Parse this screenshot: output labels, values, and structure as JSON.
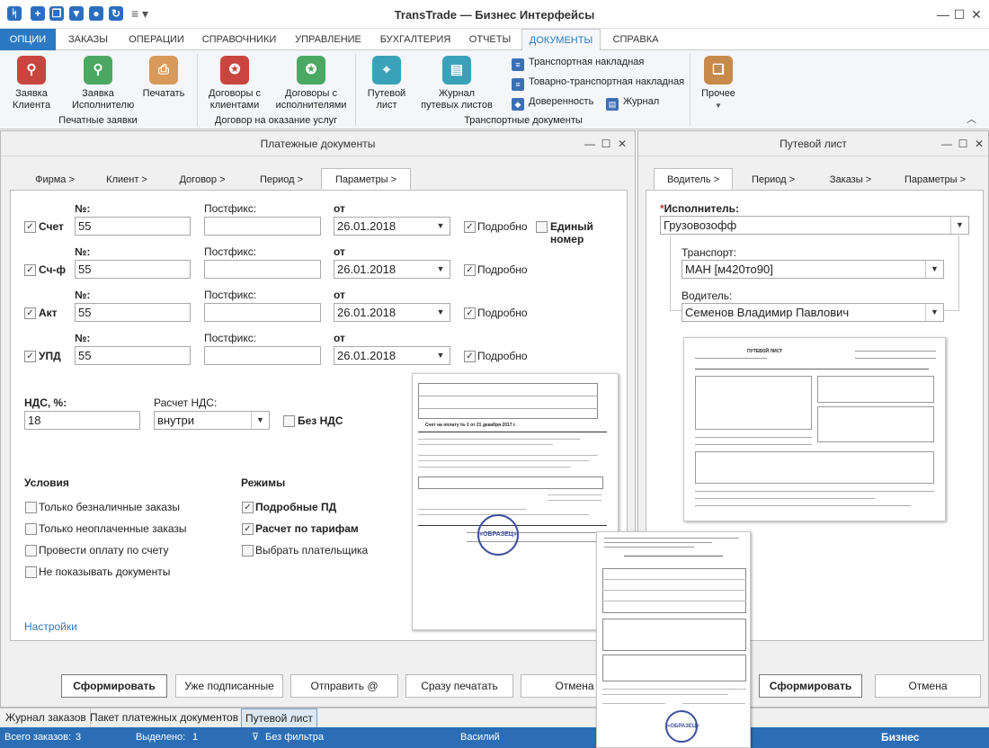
{
  "app": {
    "title": "TransTrade — Бизнес Интерфейсы"
  },
  "menu_tabs": [
    "ОПЦИИ",
    "ЗАКАЗЫ",
    "ОПЕРАЦИИ",
    "СПРАВОЧНИКИ",
    "УПРАВЛЕНИЕ",
    "БУХГАЛТЕРИЯ",
    "ОТЧЕТЫ",
    "ДОКУМЕНТЫ",
    "СПРАВКА"
  ],
  "ribbon": {
    "print_orders": {
      "client": "Заявка\nКлиента",
      "executor": "Заявка\nИсполнителю",
      "print": "Печатать",
      "group": "Печатные заявки"
    },
    "contracts": {
      "clients": "Договоры с\nклиентами",
      "executors": "Договоры с\nисполнителями",
      "group": "Договор на оказание услуг"
    },
    "transport": {
      "waybill": "Путевой\nлист",
      "waybill_journal": "Журнал\nпутевых листов",
      "consignment": "Транспортная накладная",
      "ttn": "Товарно-транспортная накладная",
      "power": "Доверенность",
      "journal": "Журнал",
      "group": "Транспортные документы"
    },
    "other": "Прочее"
  },
  "payments": {
    "title": "Платежные документы",
    "tabs": [
      "Фирма >",
      "Клиент >",
      "Договор >",
      "Период >",
      "Параметры >"
    ],
    "no_label": "№:",
    "postfix_label": "Постфикс:",
    "from_label": "от",
    "detailed": "Подробно",
    "single_number": "Единый номер",
    "rows": [
      {
        "name": "Счет",
        "number": "55",
        "date": "26.01.2018"
      },
      {
        "name": "Сч-ф",
        "number": "55",
        "date": "26.01.2018"
      },
      {
        "name": "Акт",
        "number": "55",
        "date": "26.01.2018"
      },
      {
        "name": "УПД",
        "number": "55",
        "date": "26.01.2018"
      }
    ],
    "vat_label": "НДС, %:",
    "vat_value": "18",
    "vat_calc_label": "Расчет НДС:",
    "vat_calc_value": "внутри",
    "no_vat": "Без НДС",
    "conditions_title": "Условия",
    "conditions": [
      "Только безналичные заказы",
      "Только неоплаченные заказы",
      "Провести оплату по счету",
      "Не показывать документы"
    ],
    "modes_title": "Режимы",
    "modes": [
      "Подробные ПД",
      "Расчет по тарифам",
      "Выбрать плательщика"
    ],
    "settings_link": "Настройки",
    "buttons": [
      "Сформировать",
      "Уже подписанные",
      "Отправить @",
      "Сразу печатать",
      "Отмена"
    ],
    "preview": {
      "heading": "Счет на оплату № 1 от 21 декабря 2017 г.",
      "stamp": "«ОБРАЗЕЦ»"
    }
  },
  "waybill": {
    "title": "Путевой лист",
    "tabs": [
      "Водитель >",
      "Период >",
      "Заказы >",
      "Параметры >"
    ],
    "executor_label": "Исполнитель:",
    "executor_value": "Грузовозофф",
    "transport_label": "Транспорт:",
    "transport_value": "МАН [м420то90]",
    "driver_label": "Водитель:",
    "driver_value": "Семенов Владимир Павлович",
    "preview_heading": "ПУТЕВОЙ ЛИСТ",
    "buttons": [
      "Сформировать",
      "Отмена"
    ]
  },
  "overlay_doc": {
    "stamp": "«ОБРАЗЕЦ»"
  },
  "bottom_tabs": [
    "Журнал заказов",
    "Пакет платежных документов",
    "Путевой лист"
  ],
  "status": {
    "total_label": "Всего заказов:",
    "total": "3",
    "selected_label": "Выделено:",
    "selected": "1",
    "filter": "Без фильтра",
    "user": "Василий",
    "brand": "Бизнес Интерфейсы"
  },
  "colors": {
    "accent": "#2b79c2",
    "status_bar": "#2b6eb5",
    "stamp": "#3d4f9f"
  }
}
